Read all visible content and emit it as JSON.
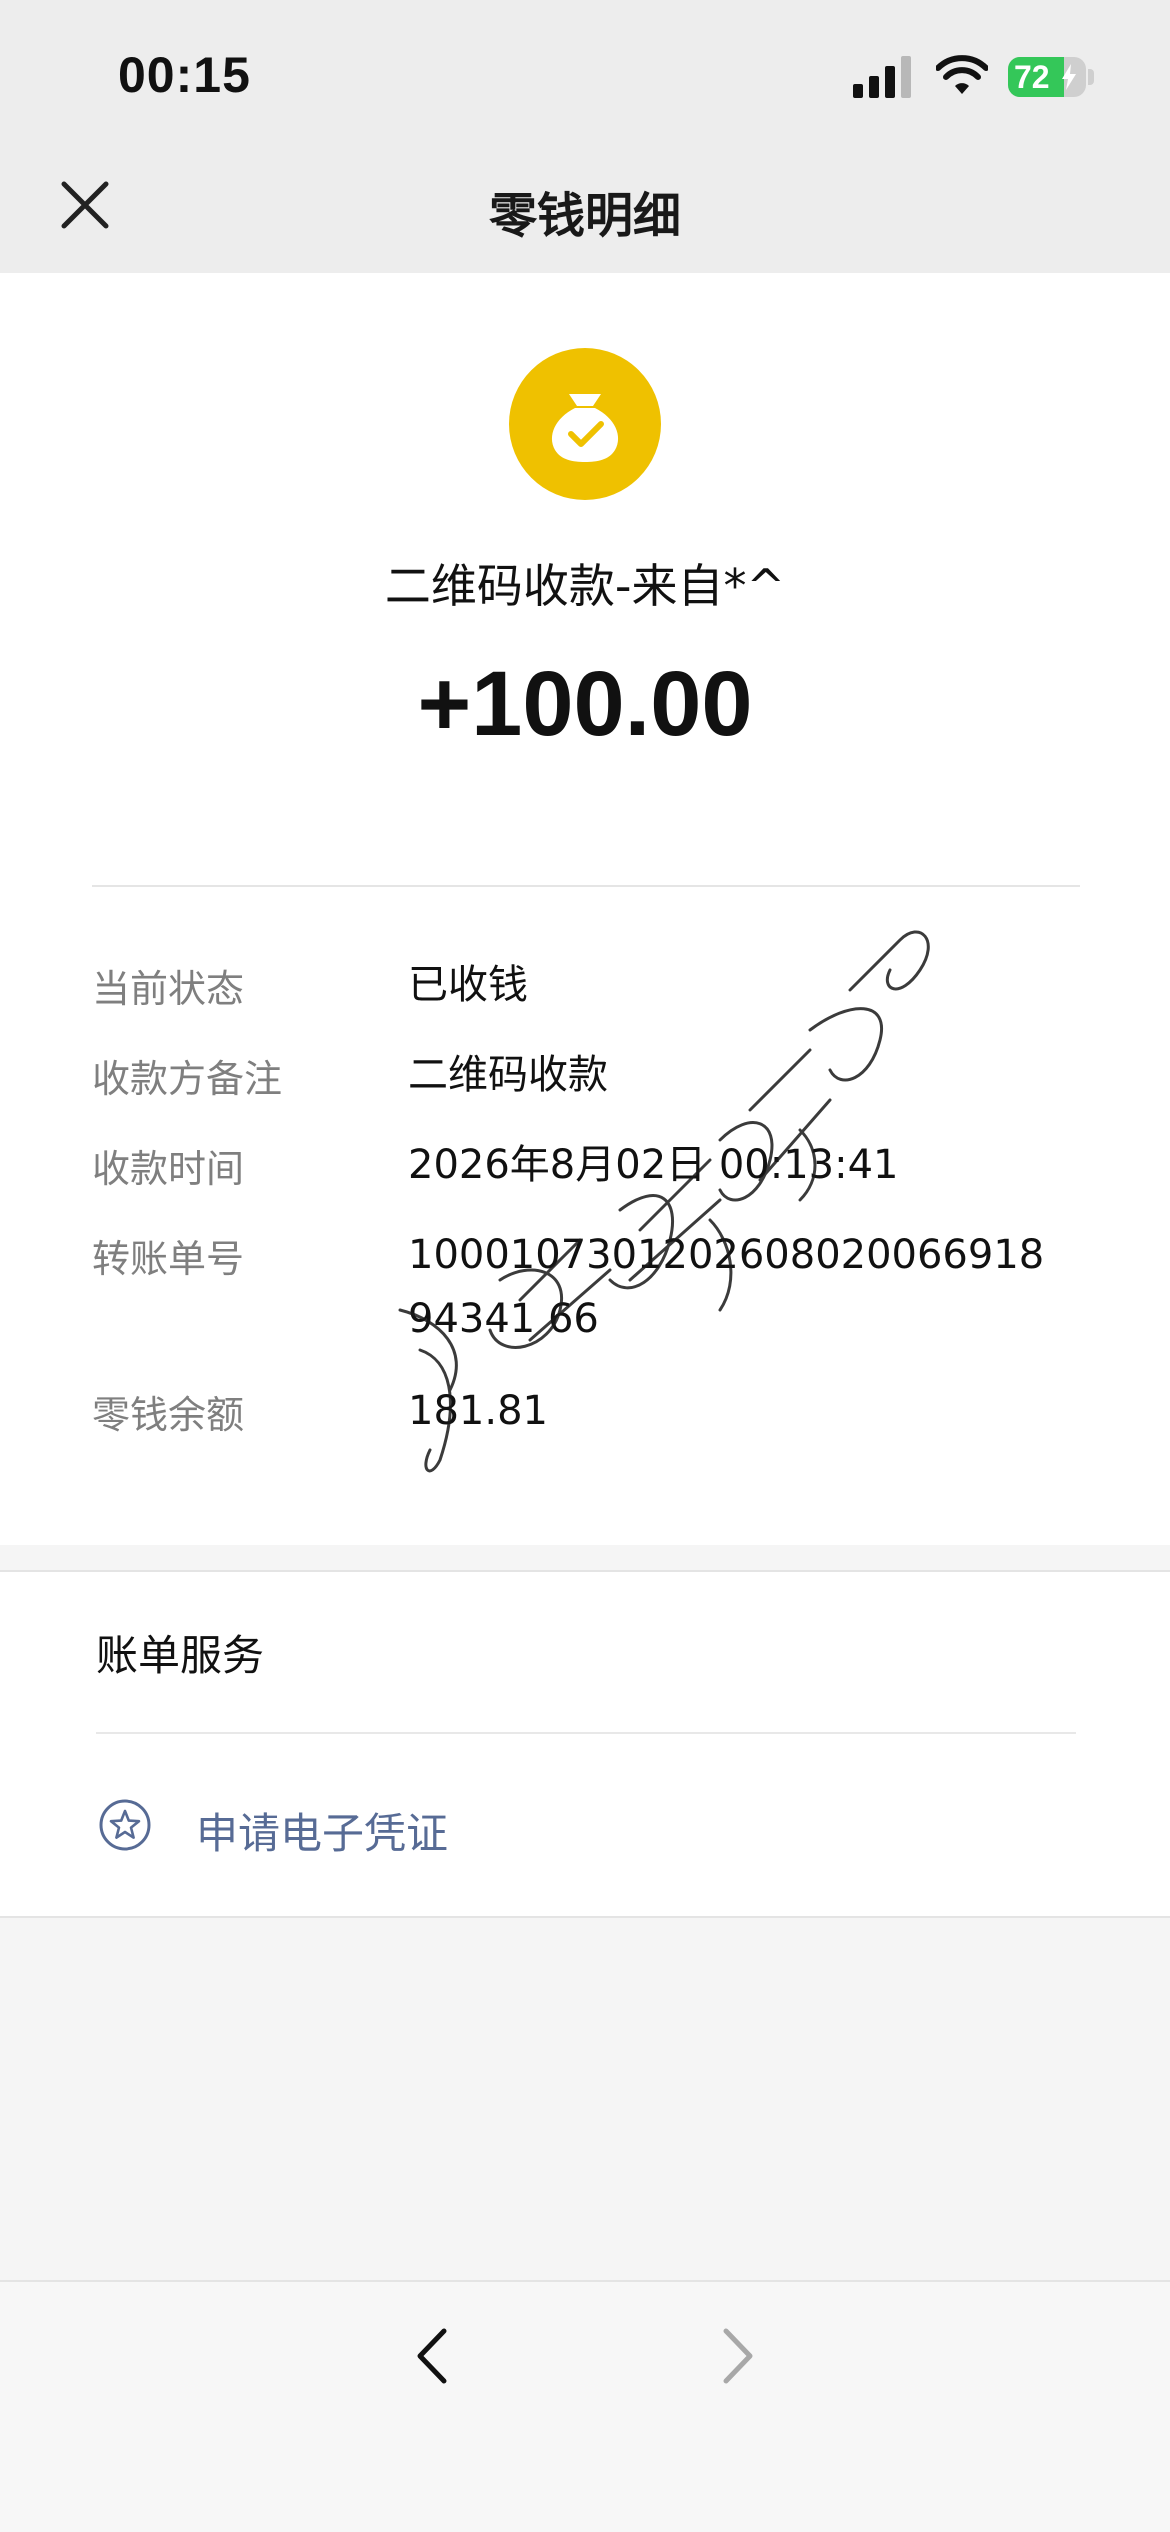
{
  "status_bar": {
    "time": "00:15",
    "battery_level": "72",
    "icons": [
      "signal-icon",
      "wifi-icon",
      "battery-icon"
    ]
  },
  "nav": {
    "title": "零钱明细",
    "close_icon": "close-icon"
  },
  "transaction": {
    "icon": "coin-bag-icon",
    "payer": "二维码收款-来自*^",
    "amount": "+100.00"
  },
  "details": [
    {
      "label": "当前状态",
      "value": "已收钱"
    },
    {
      "label": "收款方备注",
      "value": "二维码收款"
    },
    {
      "label": "收款时间",
      "value": "2026年8月02日 00:13:41"
    },
    {
      "label": "转账单号",
      "value": "100010730120260802006691894341 66"
    },
    {
      "label": "零钱余额",
      "value": "181.81"
    }
  ],
  "service": {
    "title": "账单服务",
    "voucher_label": "申请电子凭证",
    "voucher_icon": "star-badge-icon"
  },
  "bottom_bar": {
    "back_icon": "chevron-left-icon",
    "forward_icon": "chevron-right-icon"
  },
  "colors": {
    "accent_coin": "#efc100",
    "link": "#576b95",
    "battery_green": "#34c759",
    "label_gray": "#7f7f7f"
  }
}
